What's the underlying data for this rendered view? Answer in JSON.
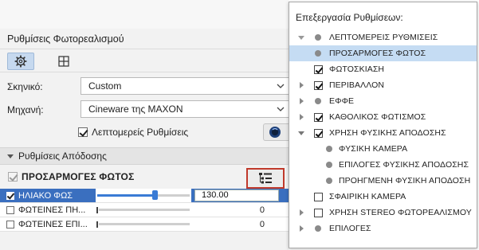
{
  "dialog": {
    "title": "Ρυθμίσεις Φωτορεαλισμού",
    "tabs": [
      {
        "icon": "gear-icon",
        "active": true
      },
      {
        "icon": "grid-view-icon",
        "active": false
      }
    ],
    "scene": {
      "label": "Σκηνικό:",
      "value": "Custom"
    },
    "engine": {
      "label": "Μηχανή:",
      "value": "Cineware της MAXON"
    },
    "detail_settings": {
      "label": "Λεπτομερείς Ρυθμίσεις",
      "checked": true
    },
    "info_icon": "cinema4d-logo-icon",
    "section": {
      "label": "Ρυθμίσεις Απόδοσης"
    },
    "adjustments": {
      "title": "ΠΡΟΣΑΡΜΟΓΕΣ ΦΩΤΟΣ",
      "checked": true
    },
    "rows": [
      {
        "name": "ΗΛΙΑΚΟ ΦΩΣ",
        "checked": true,
        "value": "130.00",
        "level": 0.62,
        "selected": true
      },
      {
        "name": "ΦΩΤΕΙΝΕΣ ΠΗ...",
        "checked": false,
        "value": "0",
        "level": 0.0,
        "selected": false
      },
      {
        "name": "ΦΩΤΕΙΝΕΣ ΕΠΙ...",
        "checked": false,
        "value": "0",
        "level": 0.0,
        "selected": false
      }
    ]
  },
  "popup": {
    "title": "Επεξεργασία Ρυθμίσεων:",
    "items": [
      {
        "label": "ΛΕΠΤΟΜΕΡΕΙΣ ΡΥΘΜΙΣΕΙΣ",
        "kind": "dot",
        "expander": "down-gray",
        "selected": false
      },
      {
        "label": "ΠΡΟΣΑΡΜΟΓΕΣ ΦΩΤΟΣ",
        "kind": "dot",
        "expander": "none",
        "selected": true
      },
      {
        "label": "ΦΩΤΟΣΚΙΑΣΗ",
        "kind": "check",
        "checked": true,
        "expander": "none",
        "selected": false
      },
      {
        "label": "ΠΕΡΙΒΑΛΛΟΝ",
        "kind": "check",
        "checked": true,
        "expander": "right",
        "selected": false
      },
      {
        "label": "ΕΦΦΕ",
        "kind": "dot",
        "expander": "right",
        "selected": false
      },
      {
        "label": "ΚΑΘΟΛΙΚΟΣ ΦΩΤΙΣΜΟΣ",
        "kind": "check",
        "checked": true,
        "expander": "right",
        "selected": false
      },
      {
        "label": "ΧΡΗΣΗ ΦΥΣΙΚΗΣ ΑΠΟΔΟΣΗΣ",
        "kind": "check",
        "checked": true,
        "expander": "down",
        "selected": false
      },
      {
        "label": "ΦΥΣΙΚΗ ΚΑΜΕΡΑ",
        "kind": "dot",
        "expander": "none",
        "selected": false,
        "child": true
      },
      {
        "label": "ΕΠΙΛΟΓΕΣ ΦΥΣΙΚΗΣ ΑΠΟΔΟΣΗΣ",
        "kind": "dot",
        "expander": "none",
        "selected": false,
        "child": true
      },
      {
        "label": "ΠΡΟΗΓΜΕΝΗ ΦΥΣΙΚΗ ΑΠΟΔΟΣΗ",
        "kind": "dot",
        "expander": "none",
        "selected": false,
        "child": true
      },
      {
        "label": "ΣΦΑΙΡΙΚΗ ΚΑΜΕΡΑ",
        "kind": "check",
        "checked": false,
        "expander": "none",
        "selected": false
      },
      {
        "label": "ΧΡΗΣΗ STEREO ΦΩΤΟΡΕΑΛΙΣΜΟΥ",
        "kind": "check",
        "checked": false,
        "expander": "right",
        "selected": false
      },
      {
        "label": "ΕΠΙΛΟΓΕΣ",
        "kind": "dot",
        "expander": "right",
        "selected": false
      }
    ]
  },
  "colors": {
    "accent": "#3a6fbf",
    "highlight_border": "#c0392b",
    "tree_selection": "#c5dcf3"
  }
}
